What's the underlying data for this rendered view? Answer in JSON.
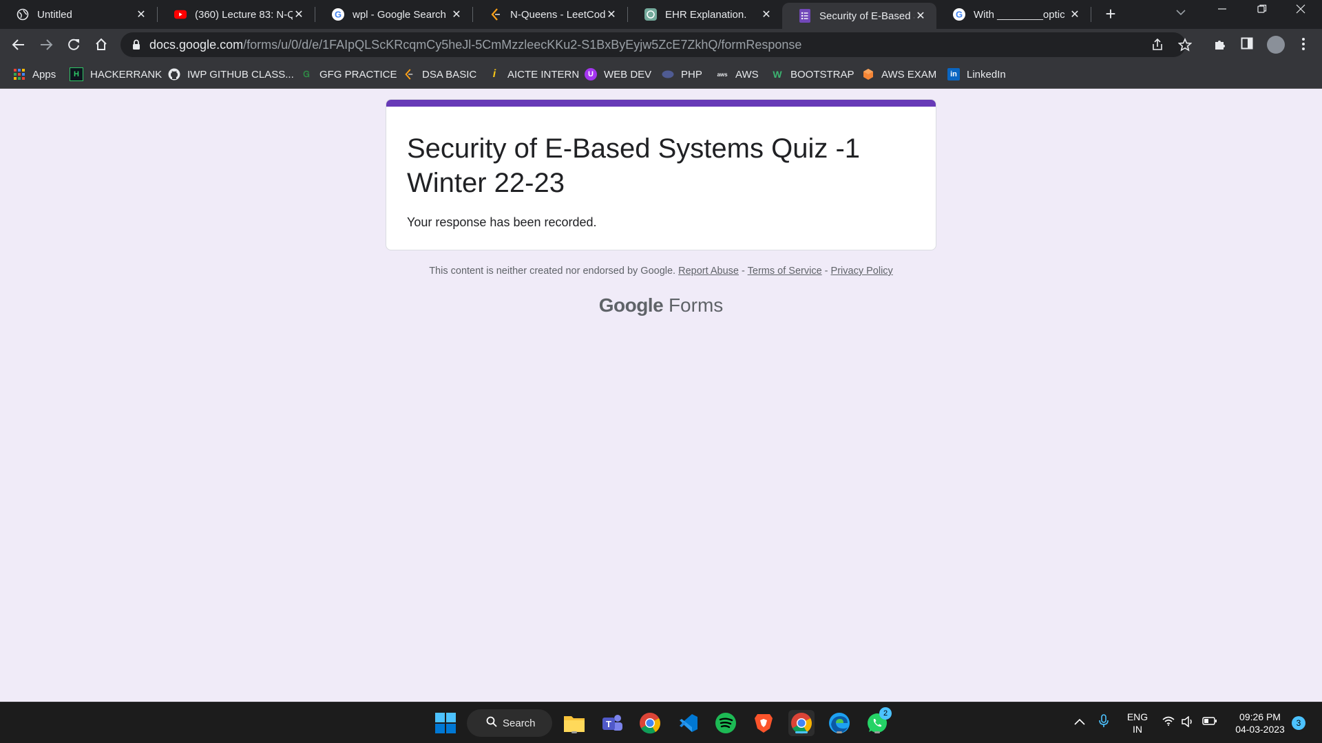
{
  "browser": {
    "tabs": [
      {
        "title": "Untitled",
        "icon": "globe-icon"
      },
      {
        "title": "(360) Lecture 83: N-Q",
        "icon": "youtube-icon"
      },
      {
        "title": "wpl - Google Search",
        "icon": "google-icon"
      },
      {
        "title": "N-Queens - LeetCode",
        "icon": "leetcode-icon"
      },
      {
        "title": "EHR Explanation.",
        "icon": "chatgpt-icon"
      },
      {
        "title": "Security of E-Based Sy",
        "icon": "google-forms-icon",
        "active": true
      },
      {
        "title": "With ________optic",
        "icon": "google-icon"
      }
    ],
    "url_host": "docs.google.com",
    "url_path": "/forms/u/0/d/e/1FAIpQLScKRcqmCy5heJl-5CmMzzleecKKu2-S1BxByEyjw5ZcE7ZkhQ/formResponse",
    "bookmarks": [
      {
        "label": "Apps",
        "icon": "apps-grid-icon"
      },
      {
        "label": "HACKERRANK",
        "icon": "hackerrank-icon"
      },
      {
        "label": "IWP GITHUB CLASS...",
        "icon": "github-icon"
      },
      {
        "label": "GFG PRACTICE",
        "icon": "gfg-icon"
      },
      {
        "label": "DSA BASIC",
        "icon": "leetcode-icon"
      },
      {
        "label": "AICTE INTERN",
        "icon": "aicte-icon"
      },
      {
        "label": "WEB DEV",
        "icon": "udemy-icon"
      },
      {
        "label": "PHP",
        "icon": "php-icon"
      },
      {
        "label": "AWS",
        "icon": "aws-icon"
      },
      {
        "label": "BOOTSTRAP",
        "icon": "bootstrap-icon"
      },
      {
        "label": "AWS EXAM",
        "icon": "aws-exam-icon"
      },
      {
        "label": "LinkedIn",
        "icon": "linkedin-icon"
      }
    ],
    "accent": "#202124"
  },
  "form": {
    "title": "Security of E-Based Systems Quiz -1 Winter 22-23",
    "message": "Your response has been recorded.",
    "accent_color": "#673ab7",
    "disclaimer": "This content is neither created nor endorsed by Google.",
    "links": {
      "report": "Report Abuse",
      "sep": "-",
      "terms": "Terms of Service",
      "privacy": "Privacy Policy"
    },
    "brand_google": "Google",
    "brand_forms": "Forms"
  },
  "taskbar": {
    "search_label": "Search",
    "whatsapp_badge": "2",
    "lang_line1": "ENG",
    "lang_line2": "IN",
    "time": "09:26 PM",
    "date": "04-03-2023",
    "notification_count": "3"
  }
}
